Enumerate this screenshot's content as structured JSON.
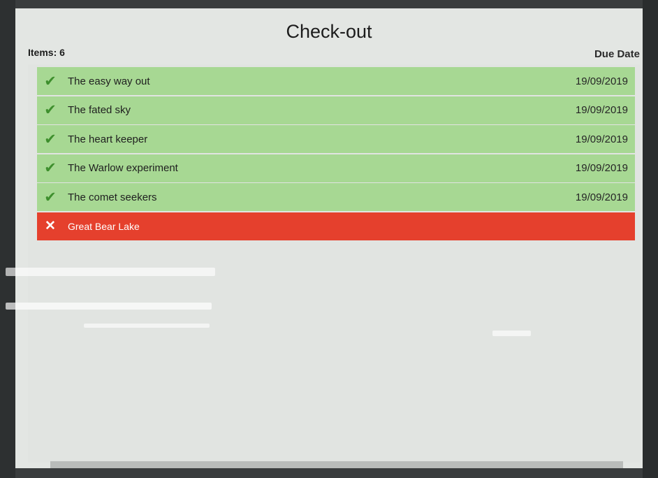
{
  "header": {
    "title": "Check-out",
    "items_label": "Items: 6",
    "due_date_label": "Due Date"
  },
  "items": [
    {
      "status": "success",
      "icon": "check-icon",
      "title": "The easy way out",
      "due": "19/09/2019"
    },
    {
      "status": "success",
      "icon": "check-icon",
      "title": "The fated sky",
      "due": "19/09/2019"
    },
    {
      "status": "success",
      "icon": "check-icon",
      "title": "The heart keeper",
      "due": "19/09/2019"
    },
    {
      "status": "success",
      "icon": "check-icon",
      "title": "The Warlow experiment",
      "due": "19/09/2019"
    },
    {
      "status": "success",
      "icon": "check-icon",
      "title": "The comet seekers",
      "due": "19/09/2019"
    },
    {
      "status": "failed",
      "icon": "cross-icon",
      "title": "Great Bear Lake",
      "due": ""
    }
  ],
  "colors": {
    "success_row": "#a7d893",
    "failed_row": "#e5402d",
    "check": "#3e8f2d",
    "screen_bg": "#e3e6e3"
  }
}
